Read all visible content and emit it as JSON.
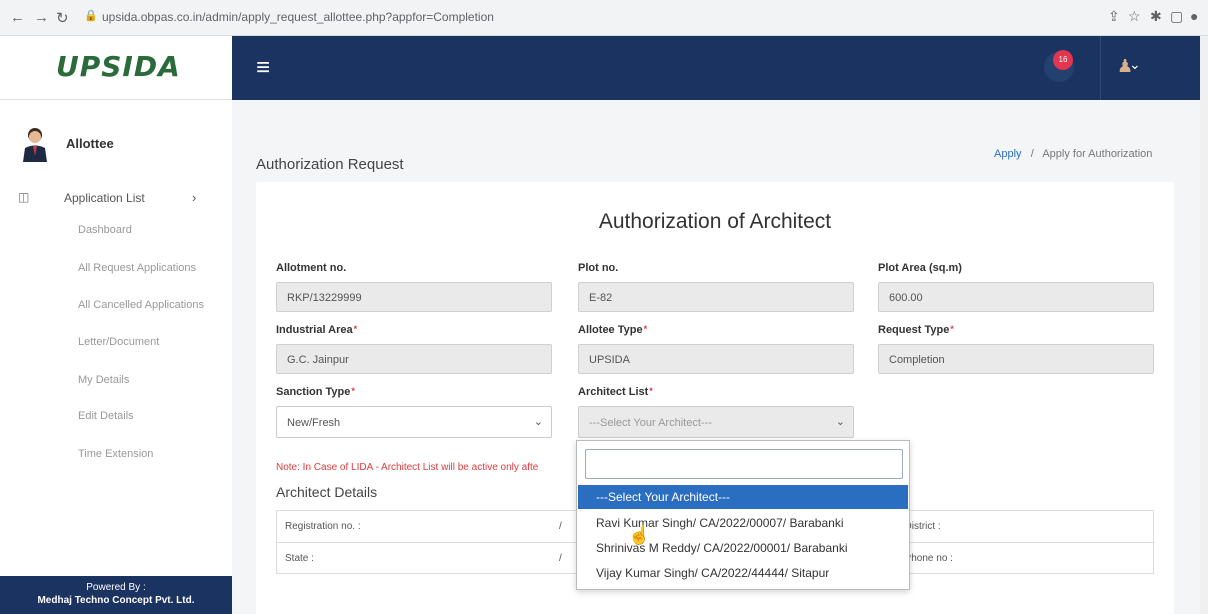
{
  "browser": {
    "url": "upsida.obpas.co.in/admin/apply_request_allottee.php?appfor=Completion"
  },
  "header": {
    "logo": "UPSIDA",
    "notification_count": "16"
  },
  "sidebar": {
    "user_label": "Allottee",
    "application_list": "Application List",
    "items": [
      {
        "label": "Dashboard"
      },
      {
        "label": "All Request Applications"
      },
      {
        "label": "All Cancelled Applications"
      },
      {
        "label": "Letter/Document"
      },
      {
        "label": "My Details"
      },
      {
        "label": "Edit Details"
      },
      {
        "label": "Time Extension"
      }
    ],
    "powered_by": "Powered By :",
    "company": "Medhaj Techno Concept Pvt. Ltd."
  },
  "page": {
    "title": "Authorization Request",
    "breadcrumb": {
      "link": "Apply",
      "separator": "/",
      "current": "Apply for Authorization"
    }
  },
  "form": {
    "heading": "Authorization of Architect",
    "allotment_no_label": "Allotment no.",
    "allotment_no": "RKP/13229999",
    "plot_no_label": "Plot no.",
    "plot_no": "E-82",
    "plot_area_label": "Plot Area (sq.m)",
    "plot_area": "600.00",
    "industrial_area_label": "Industrial Area",
    "industrial_area": "G.C. Jainpur",
    "allotee_type_label": "Allotee Type",
    "allotee_type": "UPSIDA",
    "request_type_label": "Request Type",
    "request_type": "Completion",
    "sanction_type_label": "Sanction Type",
    "sanction_type": "New/Fresh",
    "architect_list_label": "Architect List",
    "architect_placeholder": "---Select Your Architect---",
    "note": "Note: In Case of LIDA - Architect List will be active only afte",
    "architect_details_title": "Architect Details",
    "table": {
      "registration_label": "Registration no. :",
      "district_label": "t District :",
      "state_label": "State :",
      "phone_label": "t Phone no :",
      "row1_partial": "/",
      "row2_partial": "/"
    }
  },
  "dropdown": {
    "search_value": "",
    "options": [
      "---Select Your Architect---",
      "Ravi Kumar Singh/ CA/2022/00007/ Barabanki",
      "Shrinivas M Reddy/ CA/2022/00001/ Barabanki",
      "Vijay Kumar Singh/ CA/2022/44444/ Sitapur"
    ]
  },
  "colors": {
    "navbar": "#1b3360",
    "selected_option": "#2a6ec2",
    "required": "#e03c3c",
    "link": "#2a70c8"
  }
}
